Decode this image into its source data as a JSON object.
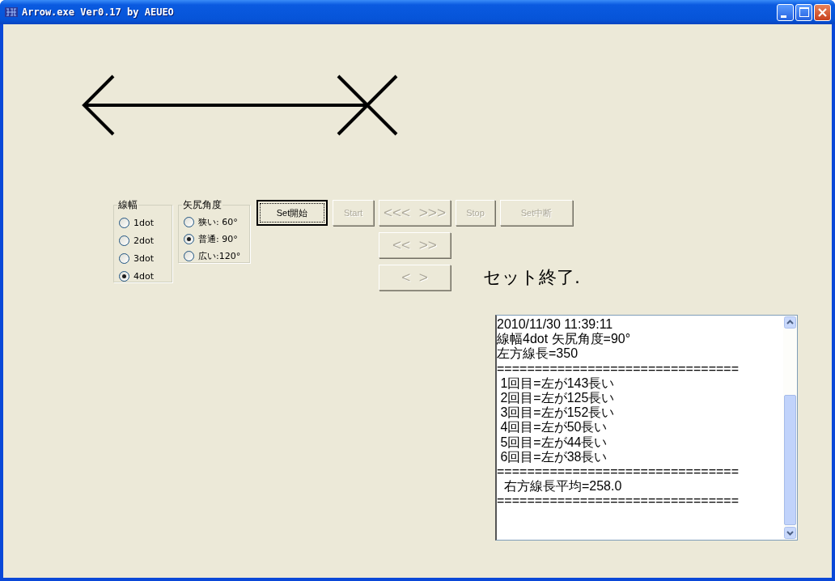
{
  "window": {
    "title": "Arrow.exe Ver0.17 by AEUEO"
  },
  "line_width": {
    "label": "線幅",
    "options": [
      {
        "label": "1dot",
        "selected": false
      },
      {
        "label": "2dot",
        "selected": false
      },
      {
        "label": "3dot",
        "selected": false
      },
      {
        "label": "4dot",
        "selected": true
      }
    ]
  },
  "arrow_angle": {
    "label": "矢尻角度",
    "options": [
      {
        "label": "狭い: 60°",
        "selected": false
      },
      {
        "label": "普通: 90°",
        "selected": true
      },
      {
        "label": "広い:120°",
        "selected": false
      }
    ]
  },
  "toolbar": [
    {
      "label": "Set開始",
      "disabled": false,
      "focused": true
    },
    {
      "label": "Start",
      "disabled": true,
      "focused": false
    },
    {
      "label": "<<<  >>>",
      "disabled": true,
      "focused": false
    },
    {
      "label": "Stop",
      "disabled": true,
      "focused": false
    },
    {
      "label": "Set中断",
      "disabled": true,
      "focused": false
    }
  ],
  "nudge_buttons": [
    {
      "label": "<<  >>",
      "disabled": true
    },
    {
      "label": "<  >",
      "disabled": true
    }
  ],
  "status": "セット終了.",
  "log": [
    "2010/11/30 11:39:11",
    "線幅4dot 矢尻角度=90°",
    "左方線長=350",
    "================================",
    " 1回目=左が143長い",
    " 2回目=左が125長い",
    " 3回目=左が152長い",
    " 4回目=左が50長い",
    " 5回目=左が44長い",
    " 6回目=左が38長い",
    "================================",
    "  右方線長平均=258.0",
    "================================"
  ]
}
